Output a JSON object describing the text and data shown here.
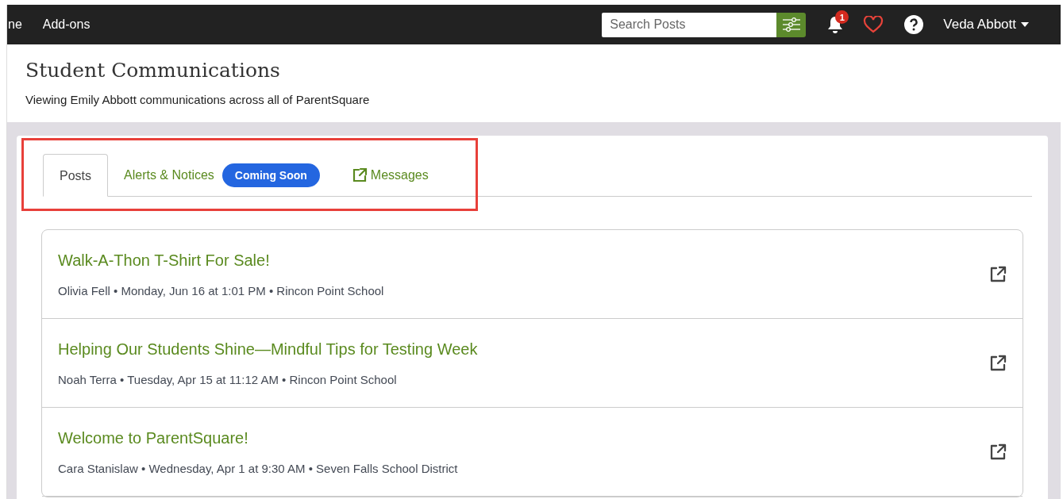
{
  "nav": {
    "items": [
      "ne",
      "Add-ons"
    ],
    "search": {
      "placeholder": "Search Posts"
    },
    "notification_count": "1",
    "user": "Veda Abbott"
  },
  "header": {
    "title": "Student Communications",
    "subtitle": "Viewing Emily Abbott communications across all of ParentSquare"
  },
  "tabs_highlighted": true,
  "tabs": [
    {
      "label": "Posts",
      "selected": true,
      "kind": "plain"
    },
    {
      "label": "Alerts & Notices",
      "selected": false,
      "kind": "badge",
      "badge": "Coming Soon"
    },
    {
      "label": "Messages",
      "selected": false,
      "kind": "external"
    }
  ],
  "posts": [
    {
      "title": "Walk-A-Thon T-Shirt For Sale!",
      "meta": "Olivia Fell • Monday, Jun 16 at 1:01 PM • Rincon Point School"
    },
    {
      "title": "Helping Our Students Shine—Mindful Tips for Testing Week",
      "meta": "Noah Terra • Tuesday, Apr 15 at 11:12 AM • Rincon Point School"
    },
    {
      "title": "Welcome to ParentSquare!",
      "meta": "Cara Stanislaw • Wednesday, Apr 1 at 9:30 AM • Seven Falls School District"
    }
  ]
}
